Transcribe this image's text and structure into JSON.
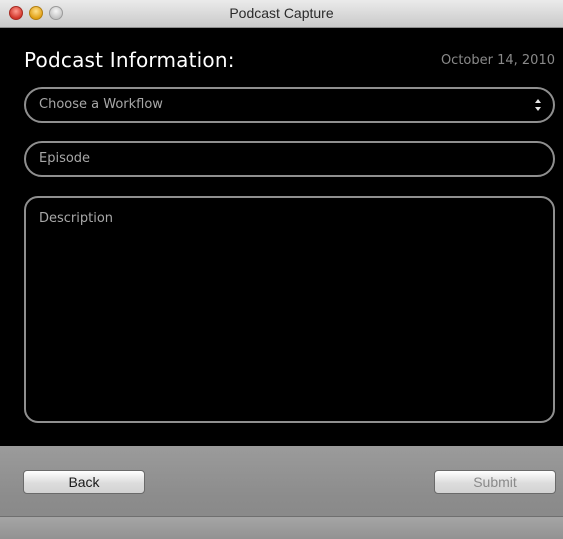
{
  "window": {
    "title": "Podcast Capture"
  },
  "header": {
    "heading": "Podcast Information:",
    "date": "October 14, 2010"
  },
  "form": {
    "workflow": {
      "selected": "Choose a Workflow",
      "icon": "stepper-arrows-icon"
    },
    "episode": {
      "placeholder": "Episode"
    },
    "description": {
      "placeholder": "Description"
    }
  },
  "footer": {
    "back_label": "Back",
    "submit_label": "Submit"
  },
  "colors": {
    "background": "#000000",
    "field_border": "#8f8f8f",
    "placeholder_text": "#a8a8a8",
    "footer": "#8c8c8c"
  }
}
